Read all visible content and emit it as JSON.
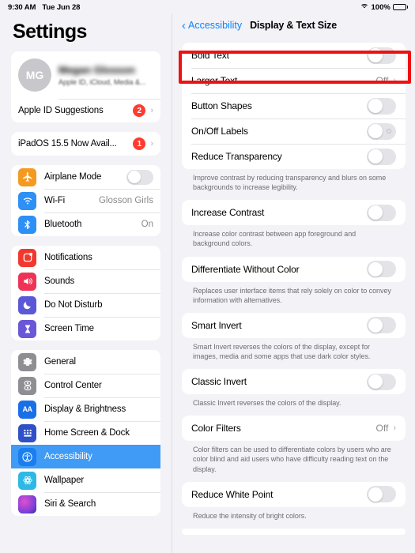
{
  "status_bar": {
    "time": "9:30 AM",
    "date": "Tue Jun 28",
    "battery_percent": "100%",
    "wifi_icon": "wifi-icon",
    "battery_icon": "battery-full-icon"
  },
  "sidebar": {
    "title": "Settings",
    "account": {
      "initials": "MG",
      "name": "Megan Glosson",
      "subtitle": "Apple ID, iCloud, Media &..."
    },
    "apple_id_suggestions": {
      "label": "Apple ID Suggestions",
      "badge": "2",
      "chevron": "›"
    },
    "update_banner": {
      "label": "iPadOS 15.5 Now Avail...",
      "badge": "1",
      "chevron": "›"
    },
    "groups": [
      {
        "items": [
          {
            "label": "Airplane Mode",
            "icon": "airplane-icon",
            "color": "#f59a21",
            "control": "toggle",
            "value": ""
          },
          {
            "label": "Wi-Fi",
            "icon": "wifi-icon",
            "color": "#2e8ff5",
            "control": "value",
            "value": "Glosson Girls"
          },
          {
            "label": "Bluetooth",
            "icon": "bluetooth-icon",
            "color": "#2e8ff5",
            "control": "value",
            "value": "On"
          }
        ]
      },
      {
        "items": [
          {
            "label": "Notifications",
            "icon": "notifications-icon",
            "color": "#f2382e",
            "control": "none",
            "value": ""
          },
          {
            "label": "Sounds",
            "icon": "sounds-icon",
            "color": "#ef3355",
            "control": "none",
            "value": ""
          },
          {
            "label": "Do Not Disturb",
            "icon": "moon-icon",
            "color": "#5a58d6",
            "control": "none",
            "value": ""
          },
          {
            "label": "Screen Time",
            "icon": "hourglass-icon",
            "color": "#6a57d8",
            "control": "none",
            "value": ""
          }
        ]
      },
      {
        "items": [
          {
            "label": "General",
            "icon": "gear-icon",
            "color": "#8e8e93",
            "control": "none",
            "value": ""
          },
          {
            "label": "Control Center",
            "icon": "control-center-icon",
            "color": "#8e8e93",
            "control": "none",
            "value": ""
          },
          {
            "label": "Display & Brightness",
            "icon": "display-brightness-icon",
            "color": "#1a6fe8",
            "control": "none",
            "value": ""
          },
          {
            "label": "Home Screen & Dock",
            "icon": "home-screen-dock-icon",
            "color": "#3050c8",
            "control": "none",
            "value": ""
          },
          {
            "label": "Accessibility",
            "icon": "accessibility-icon",
            "color": "#1a7ef0",
            "control": "none",
            "value": "",
            "selected": true
          },
          {
            "label": "Wallpaper",
            "icon": "wallpaper-icon",
            "color": "#2eb8e6",
            "control": "none",
            "value": ""
          },
          {
            "label": "Siri & Search",
            "icon": "siri-icon",
            "color": "#7a3fd8",
            "control": "none",
            "value": ""
          }
        ]
      }
    ]
  },
  "detail": {
    "back_label": "Accessibility",
    "back_chevron": "‹",
    "title": "Display & Text Size",
    "sections": [
      {
        "rows": [
          {
            "label": "Bold Text",
            "control": "toggle",
            "value": "",
            "highlighted": true
          },
          {
            "label": "Larger Text",
            "control": "disclosure",
            "value": "Off"
          },
          {
            "label": "Button Shapes",
            "control": "toggle",
            "value": ""
          },
          {
            "label": "On/Off Labels",
            "control": "toggle-labeled",
            "value": ""
          },
          {
            "label": "Reduce Transparency",
            "control": "toggle",
            "value": ""
          }
        ],
        "footer": "Improve contrast by reducing transparency and blurs on some backgrounds to increase legibility."
      },
      {
        "rows": [
          {
            "label": "Increase Contrast",
            "control": "toggle",
            "value": ""
          }
        ],
        "footer": "Increase color contrast between app foreground and background colors."
      },
      {
        "rows": [
          {
            "label": "Differentiate Without Color",
            "control": "toggle",
            "value": ""
          }
        ],
        "footer": "Replaces user interface items that rely solely on color to convey information with alternatives."
      },
      {
        "rows": [
          {
            "label": "Smart Invert",
            "control": "toggle",
            "value": ""
          }
        ],
        "footer": "Smart Invert reverses the colors of the display, except for images, media and some apps that use dark color styles."
      },
      {
        "rows": [
          {
            "label": "Classic Invert",
            "control": "toggle",
            "value": ""
          }
        ],
        "footer": "Classic Invert reverses the colors of the display."
      },
      {
        "rows": [
          {
            "label": "Color Filters",
            "control": "disclosure",
            "value": "Off"
          }
        ],
        "footer": "Color filters can be used to differentiate colors by users who are color blind and aid users who have difficulty reading text on the display."
      },
      {
        "rows": [
          {
            "label": "Reduce White Point",
            "control": "toggle",
            "value": ""
          }
        ],
        "footer": "Reduce the intensity of bright colors."
      }
    ]
  },
  "annotation": {
    "color": "#ee1111",
    "target": "Bold Text"
  }
}
